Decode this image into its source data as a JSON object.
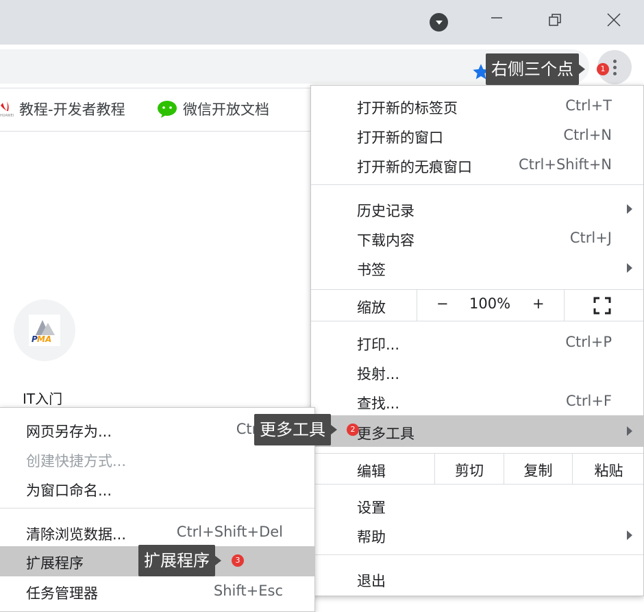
{
  "bookmarks": [
    {
      "label": "教程-开发者教程",
      "icon": "huawei-icon"
    },
    {
      "label": "微信开放文档",
      "icon": "wechat-icon"
    }
  ],
  "tile": {
    "label": "IT入门",
    "icon_text": "PMA"
  },
  "menu": {
    "group1": [
      {
        "label": "打开新的标签页",
        "shortcut": "Ctrl+T"
      },
      {
        "label": "打开新的窗口",
        "shortcut": "Ctrl+N"
      },
      {
        "label": "打开新的无痕窗口",
        "shortcut": "Ctrl+Shift+N"
      }
    ],
    "group2": [
      {
        "label": "历史记录",
        "shortcut": ""
      },
      {
        "label": "下载内容",
        "shortcut": "Ctrl+J"
      },
      {
        "label": "书签",
        "shortcut": ""
      }
    ],
    "zoom": {
      "label": "缩放",
      "minus": "−",
      "value": "100%",
      "plus": "+"
    },
    "group3": [
      {
        "label": "打印...",
        "shortcut": "Ctrl+P"
      },
      {
        "label": "投射...",
        "shortcut": ""
      },
      {
        "label": "查找...",
        "shortcut": "Ctrl+F"
      },
      {
        "label": "更多工具",
        "shortcut": ""
      }
    ],
    "edit": {
      "label": "编辑",
      "cut": "剪切",
      "copy": "复制",
      "paste": "粘贴"
    },
    "group4": [
      {
        "label": "设置",
        "shortcut": ""
      },
      {
        "label": "帮助",
        "shortcut": ""
      }
    ],
    "exit": "退出"
  },
  "submenu": {
    "group1": [
      {
        "label": "网页另存为...",
        "shortcut": "Ctrl+S"
      },
      {
        "label": "创建快捷方式...",
        "shortcut": ""
      },
      {
        "label": "为窗口命名...",
        "shortcut": ""
      }
    ],
    "group2": [
      {
        "label": "清除浏览数据...",
        "shortcut": "Ctrl+Shift+Del"
      },
      {
        "label": "扩展程序",
        "shortcut": ""
      },
      {
        "label": "任务管理器",
        "shortcut": "Shift+Esc"
      }
    ]
  },
  "callouts": [
    {
      "text": "右侧三个点",
      "badge": "1"
    },
    {
      "text": "更多工具",
      "badge": "2"
    },
    {
      "text": "扩展程序",
      "badge": "3"
    }
  ],
  "colors": {
    "highlight": "#c8c8c8",
    "callout_bg": "#4a4a4a",
    "badge": "#e53935",
    "star": "#1a73e8"
  }
}
